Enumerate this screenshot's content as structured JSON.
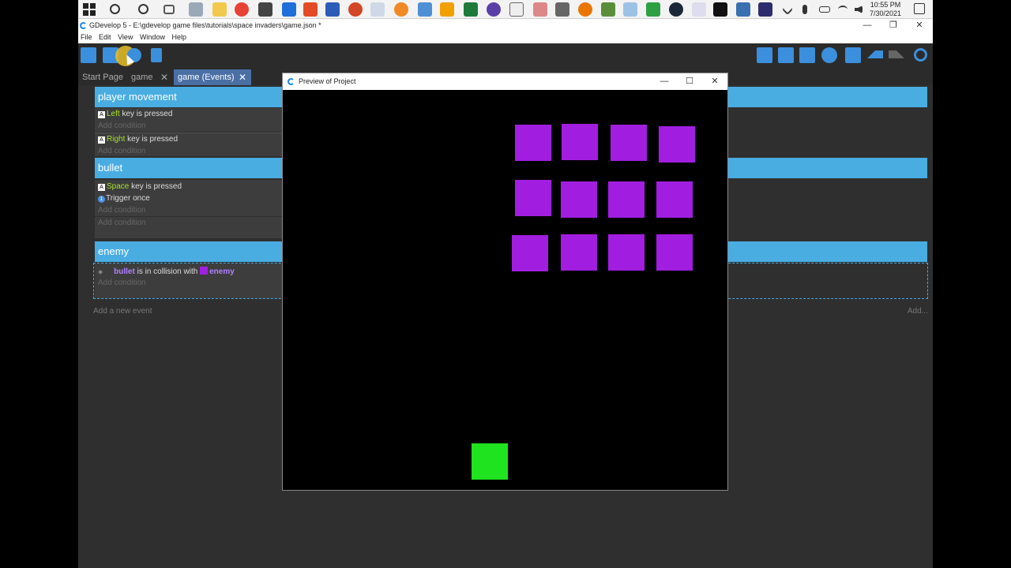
{
  "taskbar": {
    "clock_time": "10:55 PM",
    "clock_date": "7/30/2021",
    "apps": [
      "search-icon",
      "cortana-icon",
      "task-view-icon",
      "app-icon",
      "file-explorer-icon",
      "chrome-icon",
      "store-icon",
      "mail-icon",
      "office-icon",
      "word-icon",
      "powerpoint-icon",
      "gdevelop-icon",
      "app-icon",
      "settings-icon",
      "app-icon",
      "excel-icon",
      "headphones-icon",
      "app-icon",
      "app-icon",
      "app-icon",
      "blender-icon",
      "minecraft-icon",
      "app-icon",
      "app-icon",
      "steam-icon",
      "app-icon",
      "terminal-icon",
      "app-icon",
      "app-icon"
    ]
  },
  "window": {
    "title": "GDevelop 5 - E:\\gdevelop game files\\tutorials\\space invaders\\game.json *",
    "minimize": "—",
    "maximize": "❐",
    "close": "✕"
  },
  "menu": [
    "File",
    "Edit",
    "View",
    "Window",
    "Help"
  ],
  "tabs": [
    {
      "label": "Start Page"
    },
    {
      "label": "game",
      "close": "✕"
    },
    {
      "label": "game (Events)",
      "close": "✕"
    }
  ],
  "events": {
    "group1": {
      "title": "player movement",
      "cond1_key": "Left",
      "cond1_text": "key is pressed",
      "cond2_key": "Right",
      "cond2_text": "key is pressed",
      "add_condition": "Add condition"
    },
    "group2": {
      "title": "bullet",
      "cond1_key": "Space",
      "cond1_text": "key is pressed",
      "cond2_text": "Trigger once",
      "add_condition": "Add condition"
    },
    "group3": {
      "title": "enemy",
      "cond_obj1": "bullet",
      "cond_mid": "is in collision with",
      "cond_obj2": "enemy",
      "add_condition": "Add condition"
    },
    "add_event": "Add a new event",
    "add_right": "Add..."
  },
  "preview": {
    "title": "Preview of Project",
    "minimize": "—",
    "maximize": "☐",
    "close": "✕",
    "enemy_color": "#a11ee0",
    "player_color": "#1ee31e"
  }
}
